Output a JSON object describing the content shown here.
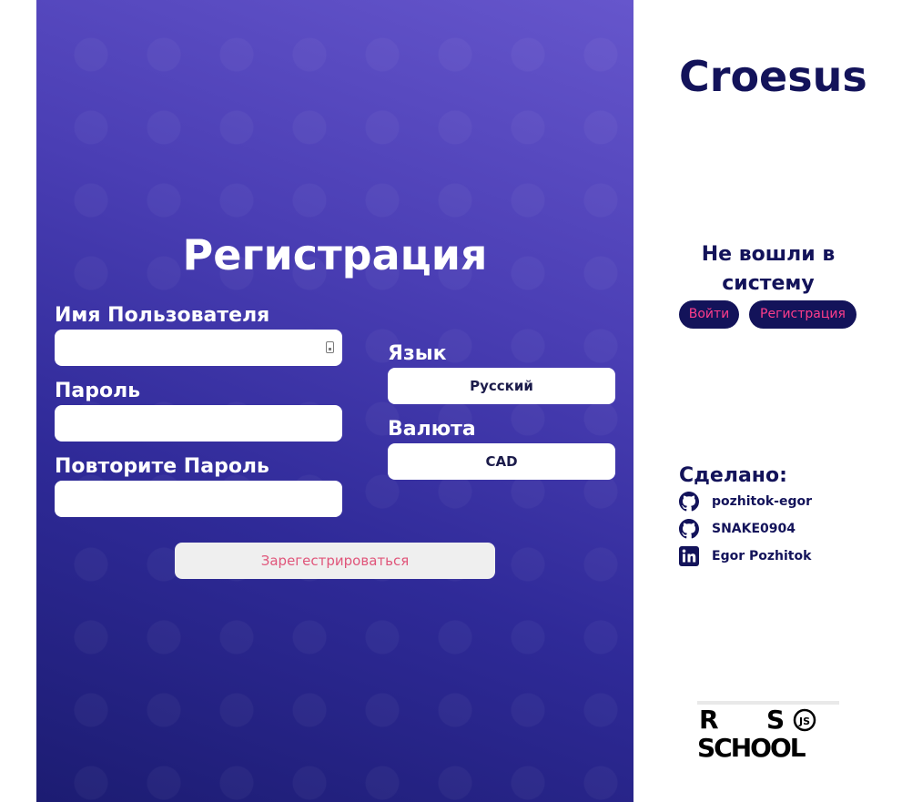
{
  "registration": {
    "title": "Регистрация",
    "username_label": "Имя Пользователя",
    "username_value": "",
    "password_label": "Пароль",
    "password_value": "",
    "repeat_password_label": "Повторите Пароль",
    "repeat_password_value": "",
    "language_label": "Язык",
    "language_value": "Русский",
    "currency_label": "Валюта",
    "currency_value": "CAD",
    "submit_label": "Зарегестрироваться",
    "input_icon": "contact-card-icon"
  },
  "sidebar": {
    "brand": "Croesus",
    "auth_status": "Не вошли в систему",
    "login_label": "Войти",
    "register_label": "Регистрация",
    "made_by_label": "Сделано:",
    "credits": [
      {
        "icon": "github-icon",
        "text": "pozhitok-egor"
      },
      {
        "icon": "github-icon",
        "text": "SNAKE0904"
      },
      {
        "icon": "linkedin-icon",
        "text": "Egor Pozhitok"
      }
    ],
    "logo": {
      "row1_left": "R",
      "row1_right": "S",
      "row2": "SCHOOL",
      "badge": "JS"
    }
  },
  "colors": {
    "brand_navy": "#13135a",
    "accent_pink": "#ff3d8b",
    "submit_text": "#e0557a",
    "panel_gradient_top": "#6656cc",
    "panel_gradient_bottom": "#1c1c72"
  }
}
